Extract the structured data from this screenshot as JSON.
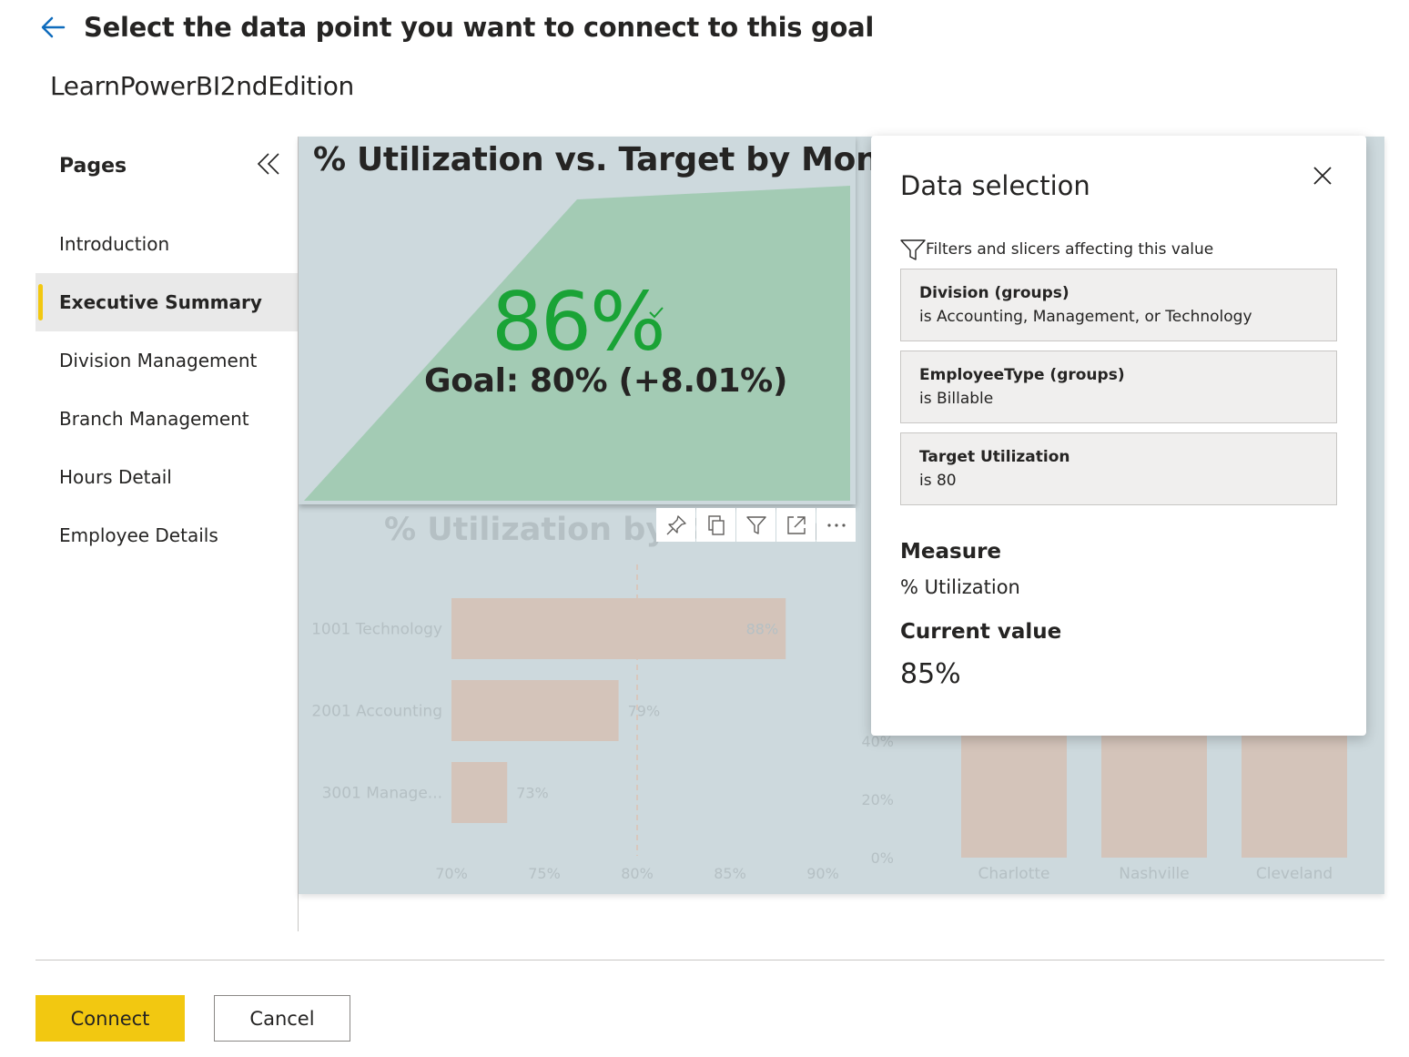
{
  "header": {
    "title": "Select the data point you want to connect to this goal",
    "back_icon": "arrow-left-icon"
  },
  "workspace": {
    "name": "LearnPowerBI2ndEdition"
  },
  "sidebar": {
    "title": "Pages",
    "collapse_icon": "double-chevron-left-icon",
    "items": [
      {
        "label": "Introduction",
        "active": false
      },
      {
        "label": "Executive Summary",
        "active": true
      },
      {
        "label": "Division Management",
        "active": false
      },
      {
        "label": "Branch Management",
        "active": false
      },
      {
        "label": "Hours Detail",
        "active": false
      },
      {
        "label": "Employee Details",
        "active": false
      }
    ],
    "active_indicator_color": "#f2c811"
  },
  "report": {
    "kpi": {
      "title": "% Utilization vs. Target by Month",
      "value": "86%",
      "goal_label": "Goal: 80%",
      "goal_delta": "(+8.01%)",
      "status_color": "#1aa336",
      "area_color": "#a3cbb4"
    },
    "bar_chart_title": "% Utilization by Division",
    "toolbar_icons": [
      "pin-icon",
      "copy-icon",
      "filter-icon",
      "focus-mode-icon",
      "more-options-icon"
    ]
  },
  "chart_data": [
    {
      "type": "bar",
      "orientation": "horizontal",
      "title": "% Utilization by Division",
      "categories": [
        "1001 Technology",
        "2001 Accounting",
        "3001 Manage..."
      ],
      "values": [
        88,
        79,
        73
      ],
      "value_labels": [
        "88%",
        "79%",
        "73%"
      ],
      "xlim": [
        70,
        90
      ],
      "x_ticks": [
        "70%",
        "75%",
        "80%",
        "85%",
        "90%"
      ],
      "reference_line": 80,
      "bar_color": "#d4c4ba"
    },
    {
      "type": "bar",
      "categories": [
        "Charlotte",
        "Nashville",
        "Cleveland"
      ],
      "y_ticks": [
        "0%",
        "20%",
        "40%"
      ],
      "ylim": [
        0,
        100
      ],
      "bar_color": "#d4c4ba"
    }
  ],
  "data_selection": {
    "title": "Data selection",
    "close_icon": "close-icon",
    "filters_label": "Filters and slicers affecting this value",
    "filters_icon": "filter-icon",
    "filters": [
      {
        "name": "Division (groups)",
        "value": "is Accounting, Management, or Technology"
      },
      {
        "name": "EmployeeType (groups)",
        "value": "is Billable"
      },
      {
        "name": "Target Utilization",
        "value": "is 80"
      }
    ],
    "measure_label": "Measure",
    "measure_value": "% Utilization",
    "current_value_label": "Current value",
    "current_value": "85%"
  },
  "footer": {
    "connect_label": "Connect",
    "cancel_label": "Cancel",
    "connect_color": "#f2c811"
  }
}
